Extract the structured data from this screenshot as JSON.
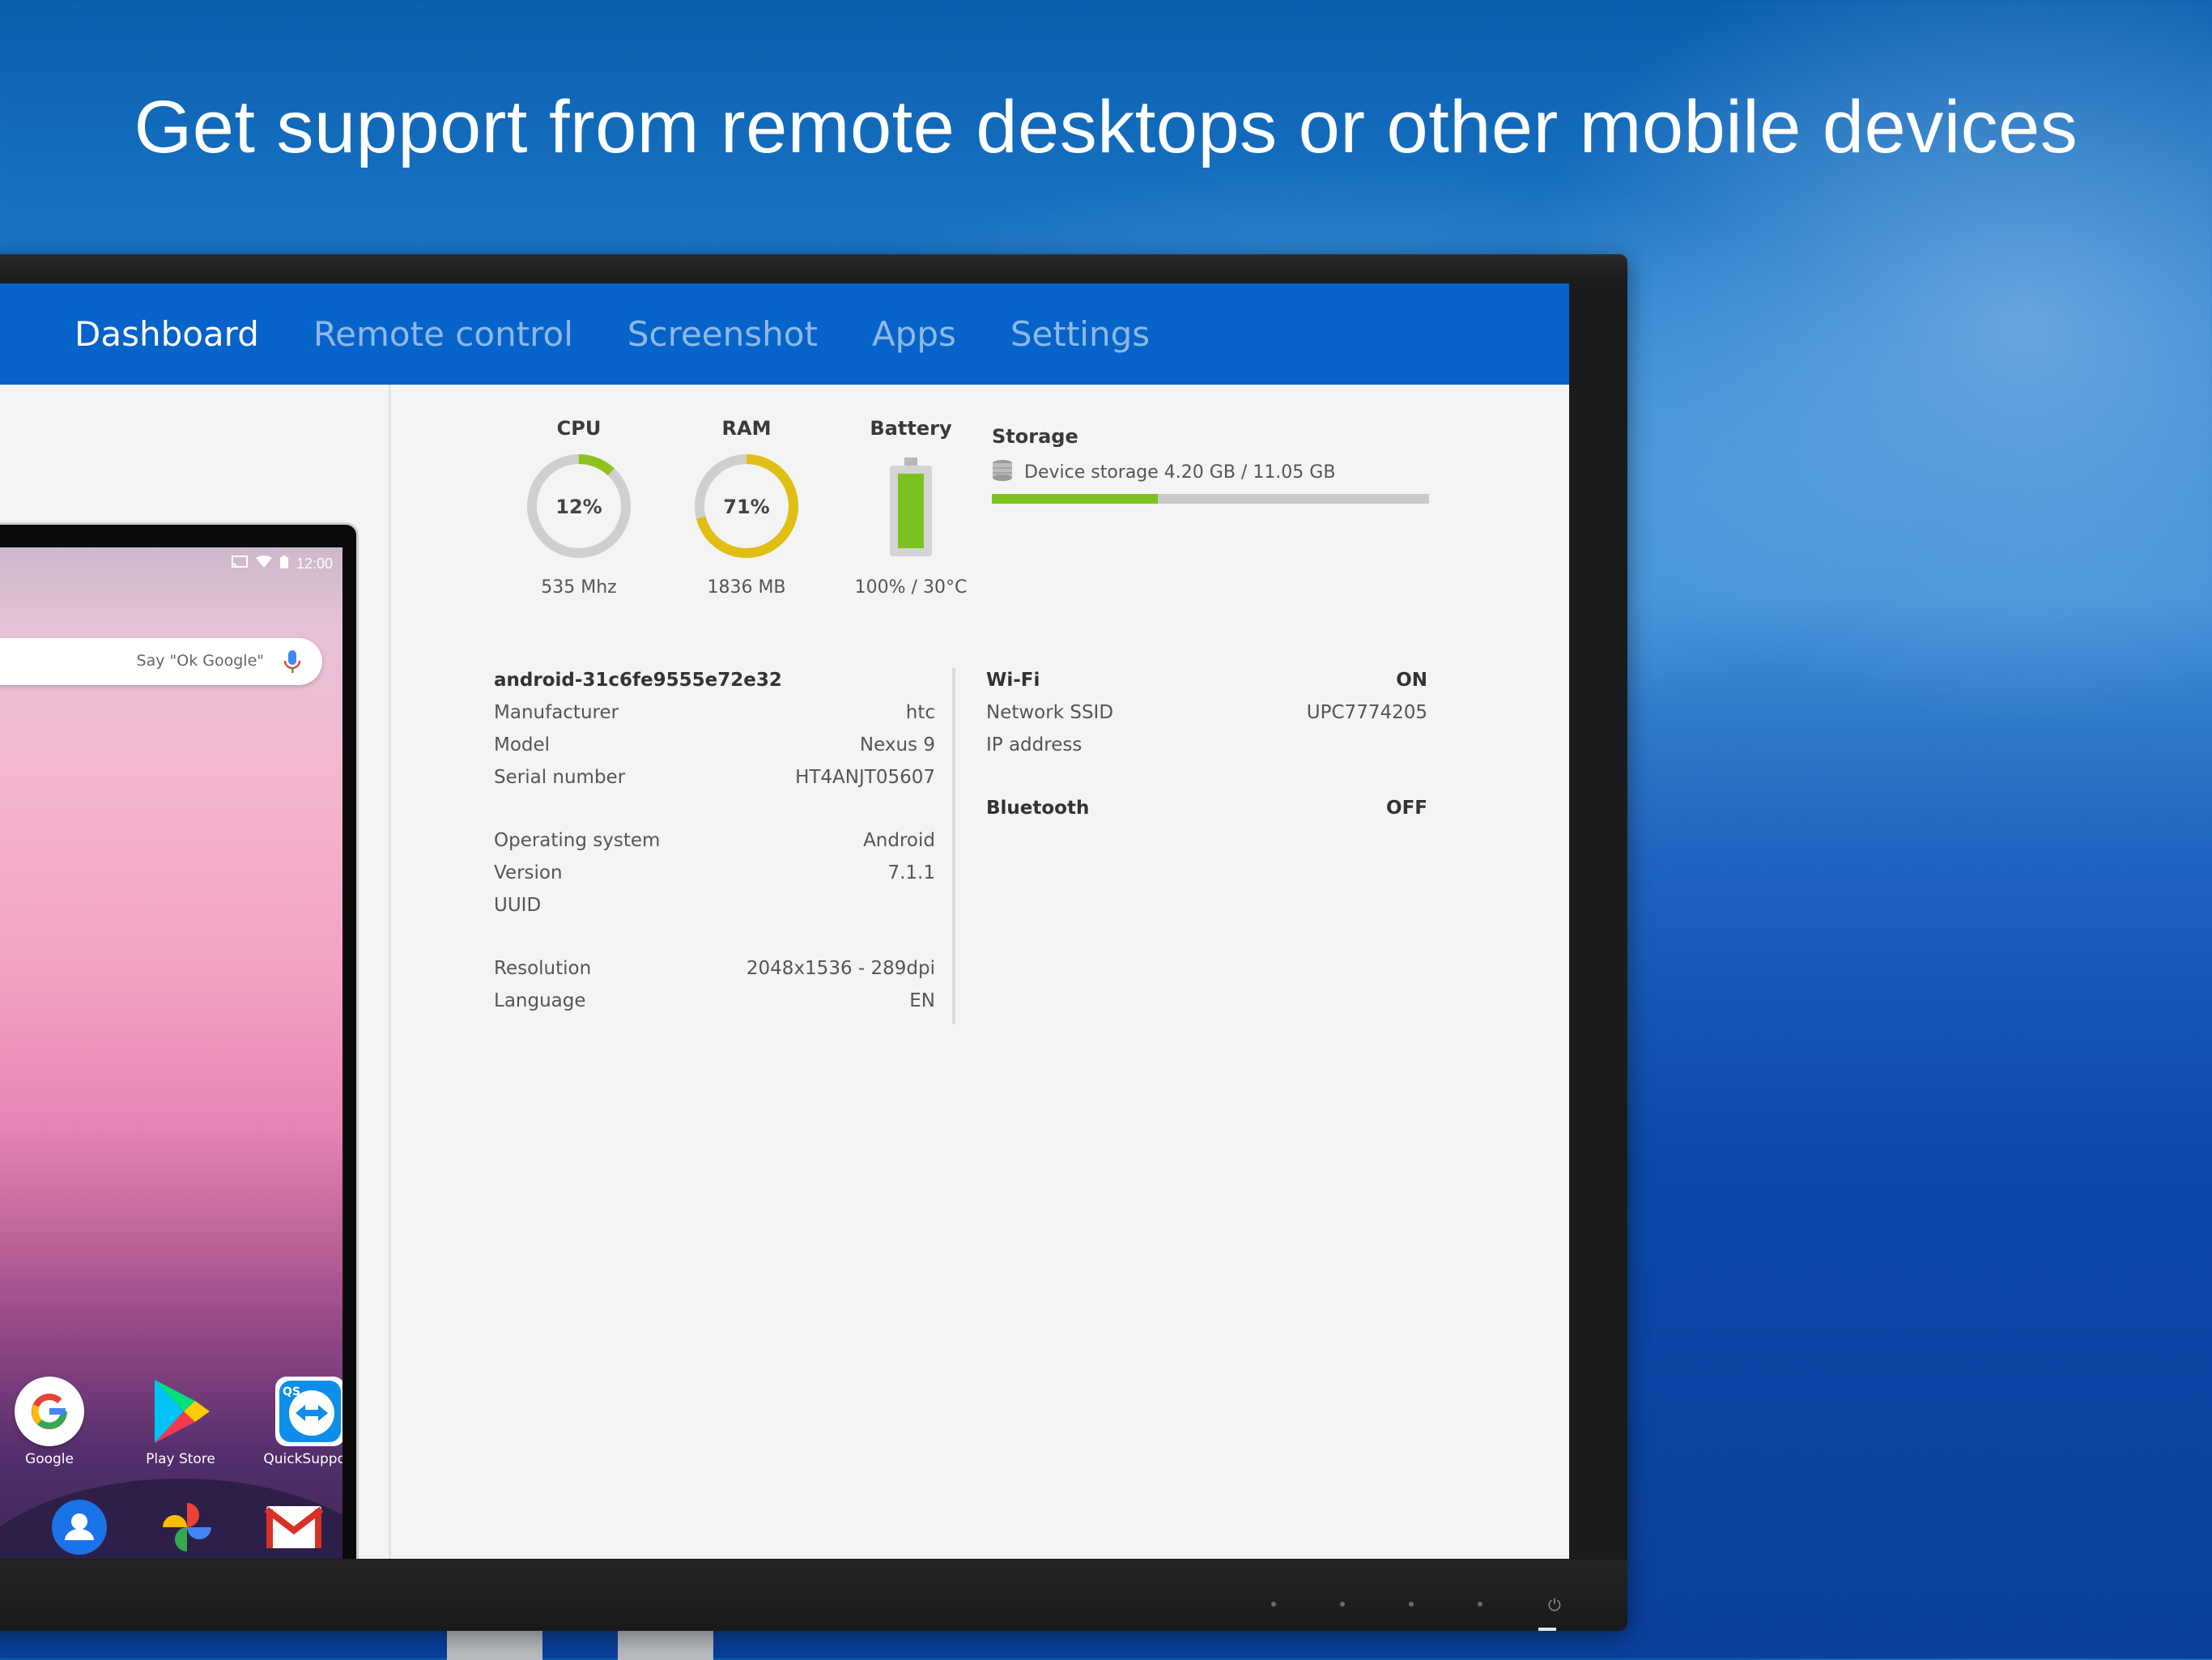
{
  "headline": "Get support from remote desktops or other mobile devices",
  "nav": {
    "tabs": [
      {
        "label": "Dashboard",
        "active": true
      },
      {
        "label": "Remote control",
        "active": false
      },
      {
        "label": "Screenshot",
        "active": false
      },
      {
        "label": "Apps",
        "active": false
      },
      {
        "label": "Settings",
        "active": false
      }
    ]
  },
  "tablet": {
    "clock": "12:00",
    "search_hint": "Say \"Ok Google\"",
    "apps": [
      {
        "label": "Google",
        "icon": "google-icon"
      },
      {
        "label": "Play Store",
        "icon": "play-store-icon"
      },
      {
        "label": "QuickSupport",
        "icon": "quicksupport-icon"
      }
    ],
    "dock": [
      "contacts-icon",
      "photos-icon",
      "gmail-icon"
    ]
  },
  "dashboard": {
    "cpu": {
      "title": "CPU",
      "value": "12%",
      "percent": 12,
      "sub": "535 Mhz",
      "color": "#8dc21f"
    },
    "ram": {
      "title": "RAM",
      "value": "71%",
      "percent": 71,
      "sub": "1836 MB",
      "color": "#e0be12"
    },
    "battery": {
      "title": "Battery",
      "percent": 100,
      "sub": "100% / 30°C",
      "color": "#7cc21e"
    },
    "storage": {
      "title": "Storage",
      "text": "Device storage 4.20 GB / 11.05 GB",
      "used_fraction": 0.38
    }
  },
  "device": {
    "name": "android-31c6fe9555e72e32",
    "rows": [
      {
        "key": "Manufacturer",
        "value": "htc"
      },
      {
        "key": "Model",
        "value": "Nexus 9"
      },
      {
        "key": "Serial number",
        "value": "HT4ANJT05607"
      },
      {
        "key": "Operating system",
        "value": "Android"
      },
      {
        "key": "Version",
        "value": "7.1.1"
      },
      {
        "key": "UUID",
        "value": ""
      },
      {
        "key": "Resolution",
        "value": "2048x1536 - 289dpi"
      },
      {
        "key": "Language",
        "value": "EN"
      }
    ]
  },
  "network": {
    "wifi": {
      "label": "Wi-Fi",
      "status": "ON"
    },
    "ssid": {
      "key": "Network SSID",
      "value": "UPC7774205"
    },
    "ip": {
      "key": "IP address",
      "value": ""
    },
    "bluetooth": {
      "label": "Bluetooth",
      "status": "OFF"
    }
  }
}
